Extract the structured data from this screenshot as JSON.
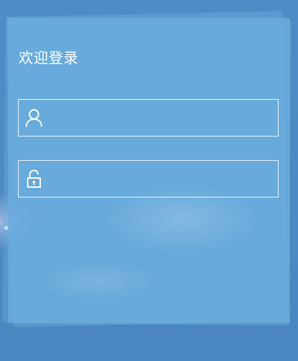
{
  "login": {
    "title": "欢迎登录",
    "username": {
      "value": "",
      "placeholder": "",
      "icon": "user-icon"
    },
    "password": {
      "value": "",
      "placeholder": "",
      "icon": "unlock-icon"
    }
  },
  "colors": {
    "background": "#4a86c1",
    "panel": "#6aacdc",
    "text": "#ffffff",
    "border": "#ffffff"
  }
}
